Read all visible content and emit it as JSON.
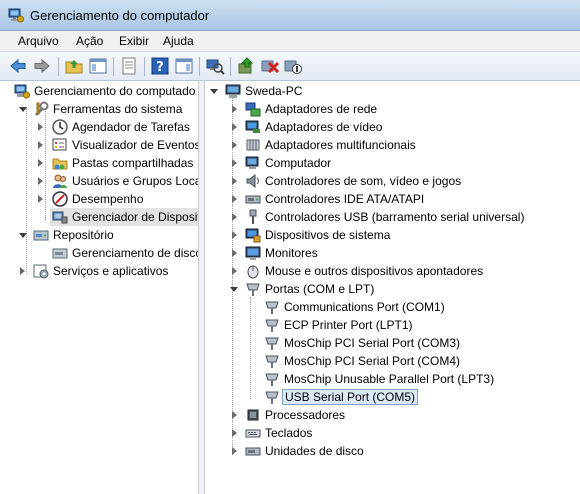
{
  "window": {
    "title": "Gerenciamento do computador"
  },
  "menu": {
    "items": [
      "Arquivo",
      "Ação",
      "Exibir",
      "Ajuda"
    ]
  },
  "left_tree": {
    "root": "Gerenciamento do computado",
    "tools": "Ferramentas do sistema",
    "items": [
      "Agendador de Tarefas",
      "Visualizador de Eventos",
      "Pastas compartilhadas",
      "Usuários e Grupos Loca",
      "Desempenho",
      "Gerenciador de Disposit"
    ],
    "storage": "Repositório",
    "disk": "Gerenciamento de disco",
    "services": "Serviços e aplicativos"
  },
  "right_tree": {
    "root": "Sweda-PC",
    "categories": [
      "Adaptadores de rede",
      "Adaptadores de vídeo",
      "Adaptadores multifuncionais",
      "Computador",
      "Controladores de som, vídeo e jogos",
      "Controladores IDE ATA/ATAPI",
      "Controladores USB (barramento serial universal)",
      "Dispositivos de sistema",
      "Monitores",
      "Mouse e outros dispositivos apontadores"
    ],
    "ports": "Portas (COM e LPT)",
    "port_items": [
      "Communications Port (COM1)",
      "ECP Printer Port (LPT1)",
      "MosChip PCI Serial Port (COM3)",
      "MosChip PCI Serial Port (COM4)",
      "MosChip Unusable Parallel Port (LPT3)",
      "USB Serial Port (COM5)"
    ],
    "after": [
      "Processadores",
      "Teclados",
      "Unidades de disco"
    ]
  }
}
